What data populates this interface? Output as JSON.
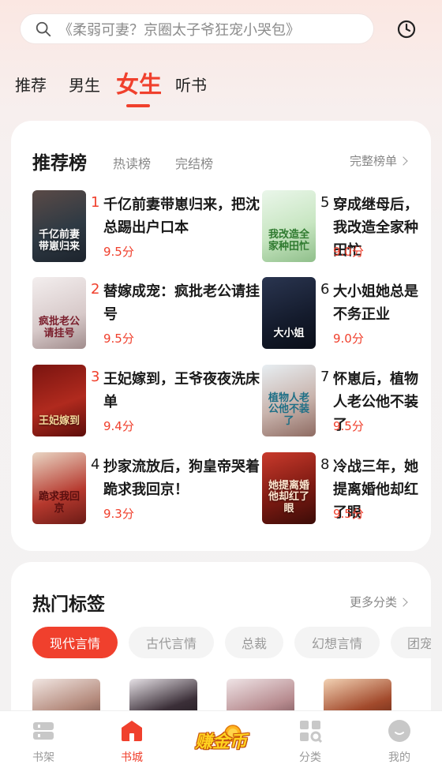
{
  "search": {
    "placeholder": "《柔弱可妻？京圈太子爷狂宠小哭包》"
  },
  "top_tabs": [
    {
      "label": "推荐"
    },
    {
      "label": "男生"
    },
    {
      "label": "女生",
      "active": true
    },
    {
      "label": "听书"
    }
  ],
  "rank_card": {
    "title": "推荐榜",
    "subtabs": [
      "热读榜",
      "完结榜"
    ],
    "more_label": "完整榜单",
    "books": [
      {
        "rank": "1",
        "title": "千亿前妻带崽归来，把沈总踢出户口本",
        "score": "9.5分",
        "cover_text": "千亿前妻带崽归来"
      },
      {
        "rank": "2",
        "title": "替嫁成宠：疯批老公请挂号",
        "score": "9.5分",
        "cover_text": "疯批老公请挂号"
      },
      {
        "rank": "3",
        "title": "王妃嫁到，王爷夜夜洗床单",
        "score": "9.4分",
        "cover_text": "王妃嫁到"
      },
      {
        "rank": "4",
        "title": "抄家流放后，狗皇帝哭着跪求我回京！",
        "score": "9.3分",
        "cover_text": "跪求我回京"
      },
      {
        "rank": "5",
        "title": "穿成继母后，我改造全家种田忙",
        "score": "9.0分",
        "cover_text": "我改造全家种田忙"
      },
      {
        "rank": "6",
        "title": "大小姐她总是不务正业",
        "score": "9.0分",
        "cover_text": "大小姐"
      },
      {
        "rank": "7",
        "title": "怀崽后，植物人老公他不装了",
        "score": "9.5分",
        "cover_text": "植物人老公他不装了"
      },
      {
        "rank": "8",
        "title": "冷战三年，她提离婚他却红了眼",
        "score": "9.5分",
        "cover_text": "她提离婚他却红了眼"
      }
    ]
  },
  "tags_card": {
    "title": "热门标签",
    "more_label": "更多分类",
    "chips": [
      "现代言情",
      "古代言情",
      "总裁",
      "幻想言情",
      "团宠"
    ]
  },
  "bottom_nav": [
    {
      "label": "书架",
      "icon": "bookshelf-icon"
    },
    {
      "label": "书城",
      "icon": "bookstore-icon",
      "active": true
    },
    {
      "label": "赚金币",
      "icon": "earn-coins-icon"
    },
    {
      "label": "分类",
      "icon": "category-icon"
    },
    {
      "label": "我的",
      "icon": "profile-icon"
    }
  ],
  "colors": {
    "accent": "#f0402d",
    "score": "#f0402d"
  }
}
